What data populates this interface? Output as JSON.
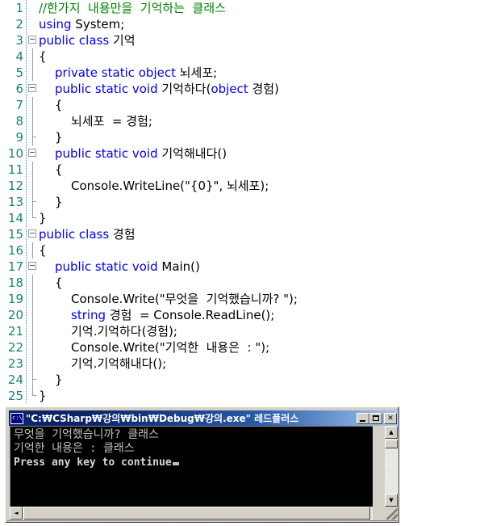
{
  "editor": {
    "lines": [
      {
        "n": "1",
        "fold": "none",
        "indent": 0,
        "segments": [
          {
            "t": "//한가지  내용만을  기억하는  클래스",
            "c": "cm"
          }
        ]
      },
      {
        "n": "2",
        "fold": "none",
        "indent": 0,
        "segments": [
          {
            "t": "using ",
            "c": "kw"
          },
          {
            "t": "System;",
            "c": "pl"
          }
        ]
      },
      {
        "n": "3",
        "fold": "open",
        "indent": 0,
        "segments": [
          {
            "t": "public class ",
            "c": "kw"
          },
          {
            "t": "기억",
            "c": "pl"
          }
        ]
      },
      {
        "n": "4",
        "fold": "line",
        "indent": 0,
        "segments": [
          {
            "t": "{",
            "c": "pl"
          }
        ]
      },
      {
        "n": "5",
        "fold": "line",
        "indent": 1,
        "segments": [
          {
            "t": "private static object ",
            "c": "kw"
          },
          {
            "t": "뇌세포;",
            "c": "pl"
          }
        ]
      },
      {
        "n": "6",
        "fold": "open",
        "indent": 1,
        "segments": [
          {
            "t": "public static void ",
            "c": "kw"
          },
          {
            "t": "기억하다(",
            "c": "pl"
          },
          {
            "t": "object ",
            "c": "kw"
          },
          {
            "t": "경험)",
            "c": "pl"
          }
        ]
      },
      {
        "n": "7",
        "fold": "line",
        "indent": 1,
        "segments": [
          {
            "t": "{",
            "c": "pl"
          }
        ]
      },
      {
        "n": "8",
        "fold": "line",
        "indent": 2,
        "segments": [
          {
            "t": "뇌세포  = 경험;",
            "c": "pl"
          }
        ]
      },
      {
        "n": "9",
        "fold": "tick",
        "indent": 1,
        "segments": [
          {
            "t": "}",
            "c": "pl"
          }
        ]
      },
      {
        "n": "10",
        "fold": "open",
        "indent": 1,
        "segments": [
          {
            "t": "public static void ",
            "c": "kw"
          },
          {
            "t": "기억해내다()",
            "c": "pl"
          }
        ]
      },
      {
        "n": "11",
        "fold": "line",
        "indent": 1,
        "segments": [
          {
            "t": "{",
            "c": "pl"
          }
        ]
      },
      {
        "n": "12",
        "fold": "line",
        "indent": 2,
        "segments": [
          {
            "t": "Console.WriteLine(\"{0}\", 뇌세포);",
            "c": "pl"
          }
        ]
      },
      {
        "n": "13",
        "fold": "tick",
        "indent": 1,
        "segments": [
          {
            "t": "}",
            "c": "pl"
          }
        ]
      },
      {
        "n": "14",
        "fold": "end",
        "indent": 0,
        "segments": [
          {
            "t": "}",
            "c": "pl"
          }
        ]
      },
      {
        "n": "15",
        "fold": "open",
        "indent": 0,
        "segments": [
          {
            "t": "public class ",
            "c": "kw"
          },
          {
            "t": "경험",
            "c": "pl"
          }
        ]
      },
      {
        "n": "16",
        "fold": "line",
        "indent": 0,
        "segments": [
          {
            "t": "{",
            "c": "pl"
          }
        ]
      },
      {
        "n": "17",
        "fold": "open",
        "indent": 1,
        "segments": [
          {
            "t": "public static void ",
            "c": "kw"
          },
          {
            "t": "Main()",
            "c": "pl"
          }
        ]
      },
      {
        "n": "18",
        "fold": "line",
        "indent": 1,
        "segments": [
          {
            "t": "{",
            "c": "pl"
          }
        ]
      },
      {
        "n": "19",
        "fold": "line",
        "indent": 2,
        "segments": [
          {
            "t": "Console.Write(\"무엇을  기억했습니까? \");",
            "c": "pl"
          }
        ]
      },
      {
        "n": "20",
        "fold": "line",
        "indent": 2,
        "segments": [
          {
            "t": "string ",
            "c": "kw"
          },
          {
            "t": "경험  = Console.ReadLine();",
            "c": "pl"
          }
        ]
      },
      {
        "n": "21",
        "fold": "line",
        "indent": 2,
        "segments": [
          {
            "t": "기억.기억하다(경험);",
            "c": "pl"
          }
        ]
      },
      {
        "n": "22",
        "fold": "line",
        "indent": 2,
        "segments": [
          {
            "t": "Console.Write(\"기억한  내용은  : \");",
            "c": "pl"
          }
        ]
      },
      {
        "n": "23",
        "fold": "line",
        "indent": 2,
        "segments": [
          {
            "t": "기억.기억해내다();",
            "c": "pl"
          }
        ]
      },
      {
        "n": "24",
        "fold": "tick",
        "indent": 1,
        "segments": [
          {
            "t": "}",
            "c": "pl"
          }
        ]
      },
      {
        "n": "25",
        "fold": "end",
        "indent": 0,
        "segments": [
          {
            "t": "}",
            "c": "pl"
          }
        ]
      }
    ],
    "colors": {
      "keyword": "#0000ee",
      "comment": "#008000",
      "plain": "#000000",
      "line_number": "#1a8080",
      "background": "#ffffff"
    }
  },
  "console_window": {
    "title": "\"C:₩CSharp₩강의₩bin₩Debug₩강의.exe\" 레드플러스",
    "icon": "console-app-icon",
    "buttons": {
      "minimize": "minimize-button",
      "maximize": "maximize-button",
      "close_label": "✕"
    },
    "output": [
      {
        "text": "무엇을 기억했습니까? 클래스",
        "style": "normal"
      },
      {
        "text": "기억한 내용은 : 클래스",
        "style": "normal"
      },
      {
        "text": "Press any key to continue",
        "style": "bright"
      }
    ],
    "scrollbars": {
      "v_up": "▲",
      "v_down": "▼",
      "h_left": "◄",
      "h_right": "►"
    },
    "colors": {
      "screen_background": "#000000",
      "screen_text": "#c0c0c0",
      "titlebar_start": "#0a246a",
      "titlebar_end": "#a6caf0",
      "chrome": "#d4d0c8"
    }
  }
}
